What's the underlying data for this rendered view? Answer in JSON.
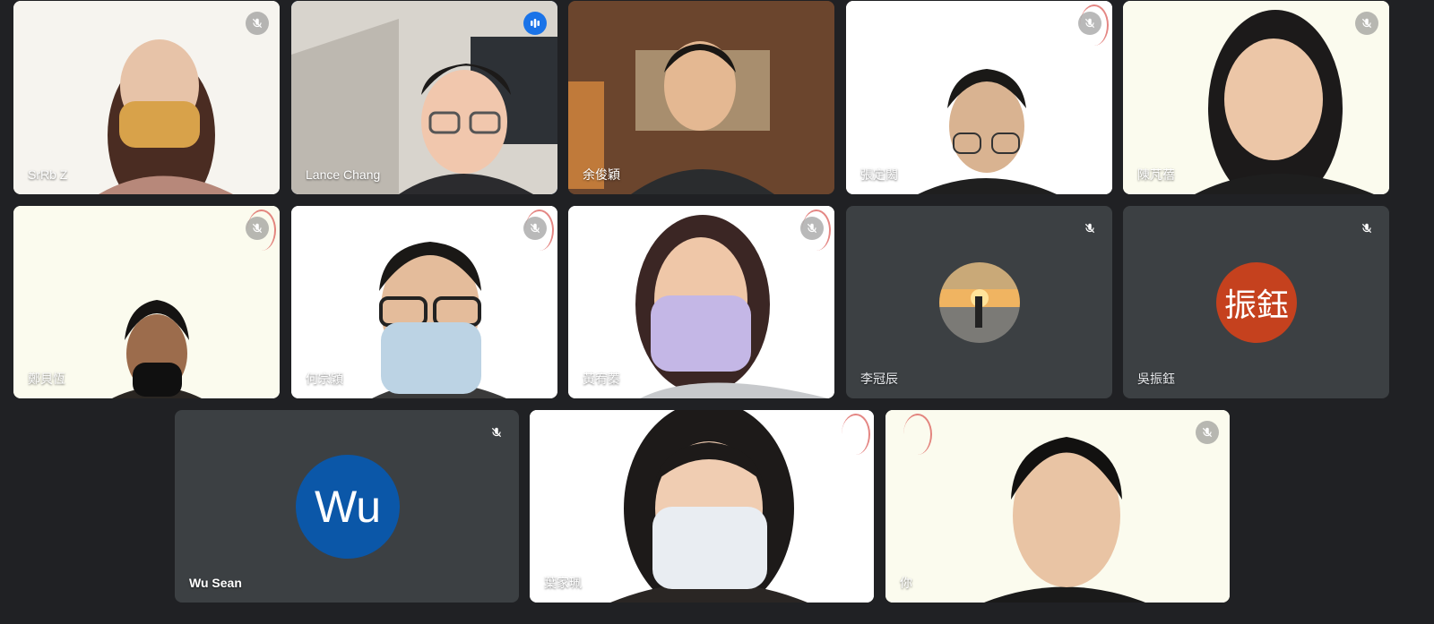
{
  "meeting": {
    "participants": [
      {
        "id": "p1",
        "name": "SrRb Z",
        "muted": true,
        "view": "video",
        "speaking": false
      },
      {
        "id": "p2",
        "name": "Lance Chang",
        "muted": false,
        "view": "video",
        "speaking": true
      },
      {
        "id": "p3",
        "name": "余俊穎",
        "muted": false,
        "view": "video",
        "speaking": false
      },
      {
        "id": "p4",
        "name": "張定閎",
        "muted": true,
        "view": "video",
        "speaking": false
      },
      {
        "id": "p5",
        "name": "陳芃蓓",
        "muted": true,
        "view": "video",
        "speaking": false
      },
      {
        "id": "p6",
        "name": "鄭貝恆",
        "muted": true,
        "view": "video",
        "speaking": false
      },
      {
        "id": "p7",
        "name": "何宗穎",
        "muted": true,
        "view": "video",
        "speaking": false
      },
      {
        "id": "p8",
        "name": "黃宥蓁",
        "muted": true,
        "view": "video",
        "speaking": false
      },
      {
        "id": "p9",
        "name": "李冠辰",
        "muted": true,
        "view": "avatar-photo",
        "speaking": false
      },
      {
        "id": "p10",
        "name": "吳振鈺",
        "muted": true,
        "view": "avatar-initials",
        "avatar_text": "振鈺",
        "avatar_color": "#c5411e",
        "speaking": false
      },
      {
        "id": "p11",
        "name": "Wu Sean",
        "muted": true,
        "view": "avatar-initials",
        "avatar_text": "Wu",
        "avatar_color": "#0b57a8",
        "speaking": false
      },
      {
        "id": "p12",
        "name": "葉家珮",
        "muted": false,
        "view": "video",
        "speaking": false
      },
      {
        "id": "p13",
        "name": "你",
        "muted": true,
        "view": "video",
        "speaking": false
      }
    ]
  },
  "colors": {
    "background": "#202124",
    "tile_off": "#3c4043",
    "speaking_border": "#669df6",
    "speaking_badge": "#1a73e8"
  },
  "icons": {
    "muted": "mic-off-icon",
    "speaking": "audio-level-icon"
  }
}
